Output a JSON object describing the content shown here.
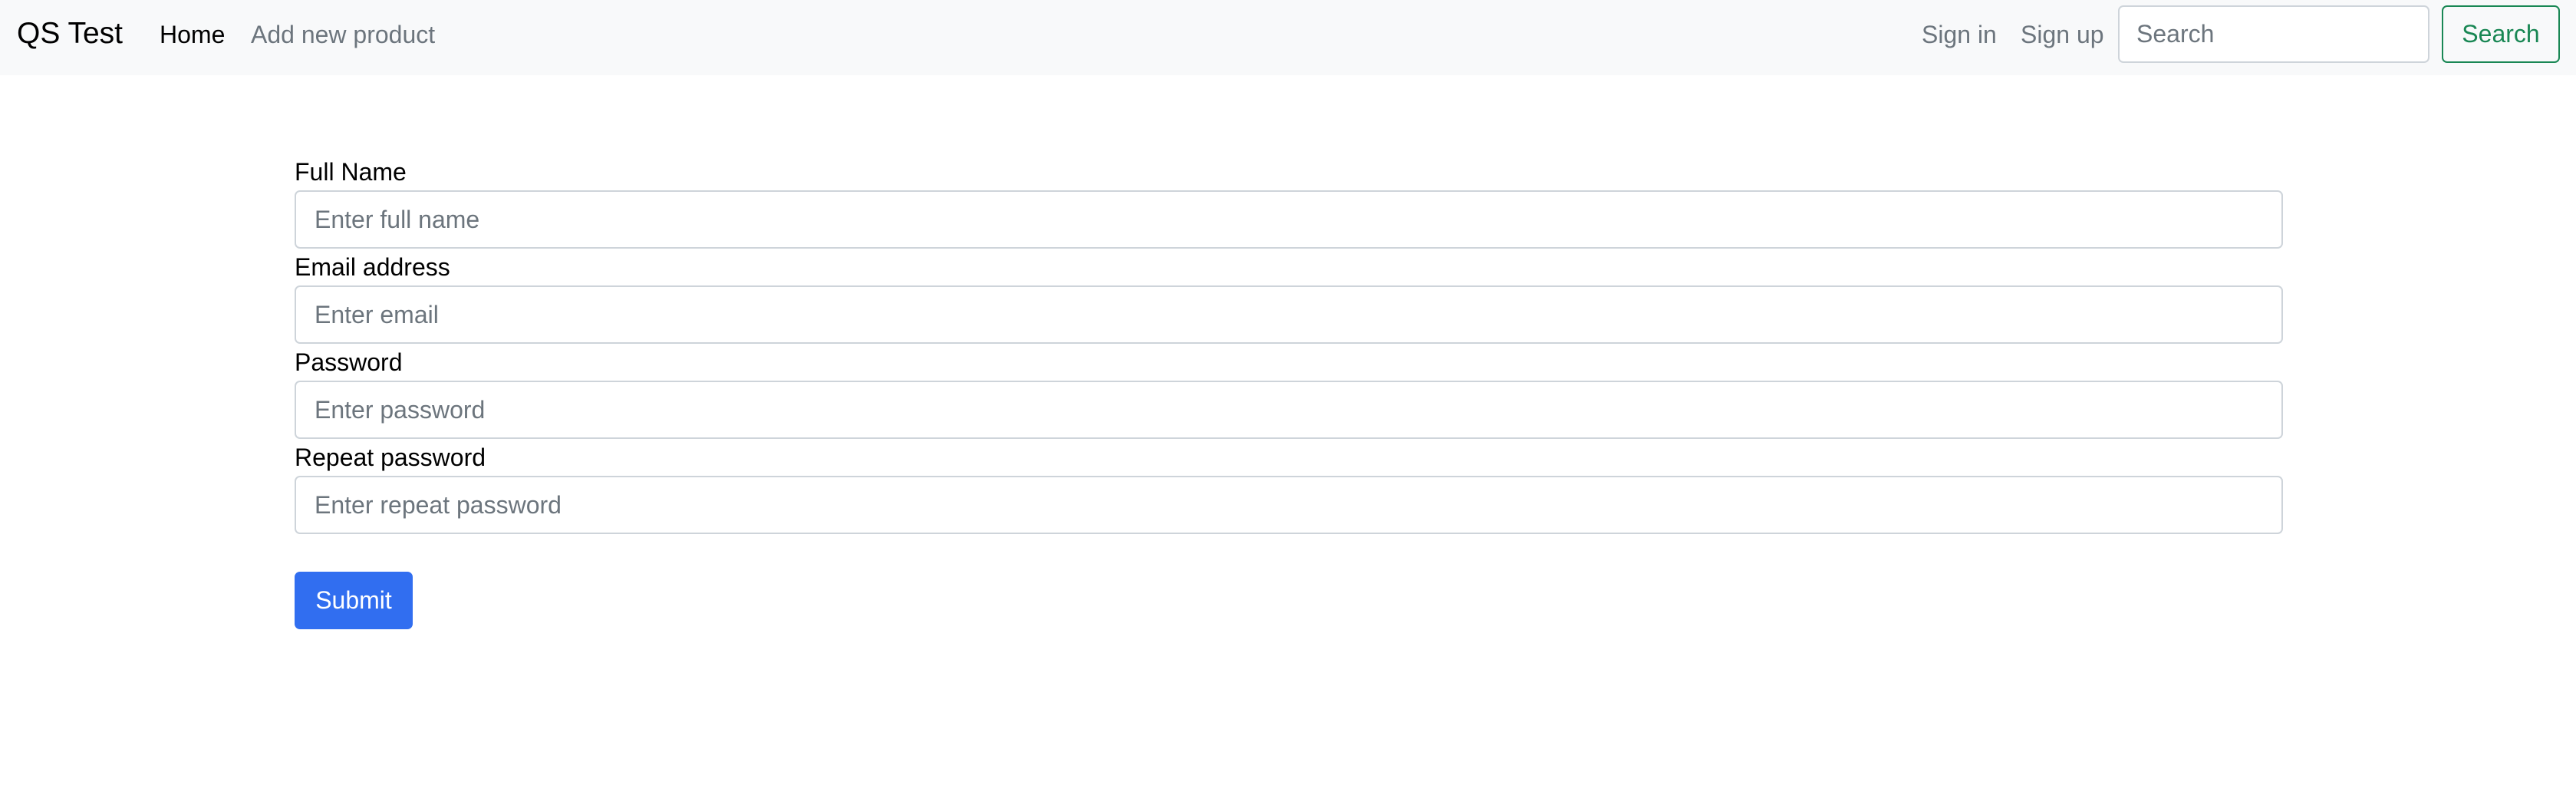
{
  "navbar": {
    "brand": "QS Test",
    "links": [
      {
        "label": "Home",
        "active": true
      },
      {
        "label": "Add new product",
        "active": false
      }
    ],
    "auth_links": [
      {
        "label": "Sign in"
      },
      {
        "label": "Sign up"
      }
    ],
    "search": {
      "placeholder": "Search",
      "value": "",
      "button_label": "Search"
    }
  },
  "form": {
    "fields": [
      {
        "label": "Full Name",
        "placeholder": "Enter full name",
        "value": ""
      },
      {
        "label": "Email address",
        "placeholder": "Enter email",
        "value": ""
      },
      {
        "label": "Password",
        "placeholder": "Enter password",
        "value": ""
      },
      {
        "label": "Repeat password",
        "placeholder": "Enter repeat password",
        "value": ""
      }
    ],
    "submit_label": "Submit"
  },
  "colors": {
    "navbar_bg": "#f8f9fa",
    "primary": "#316ef0",
    "success": "#198754",
    "muted_text": "#6c757d"
  }
}
